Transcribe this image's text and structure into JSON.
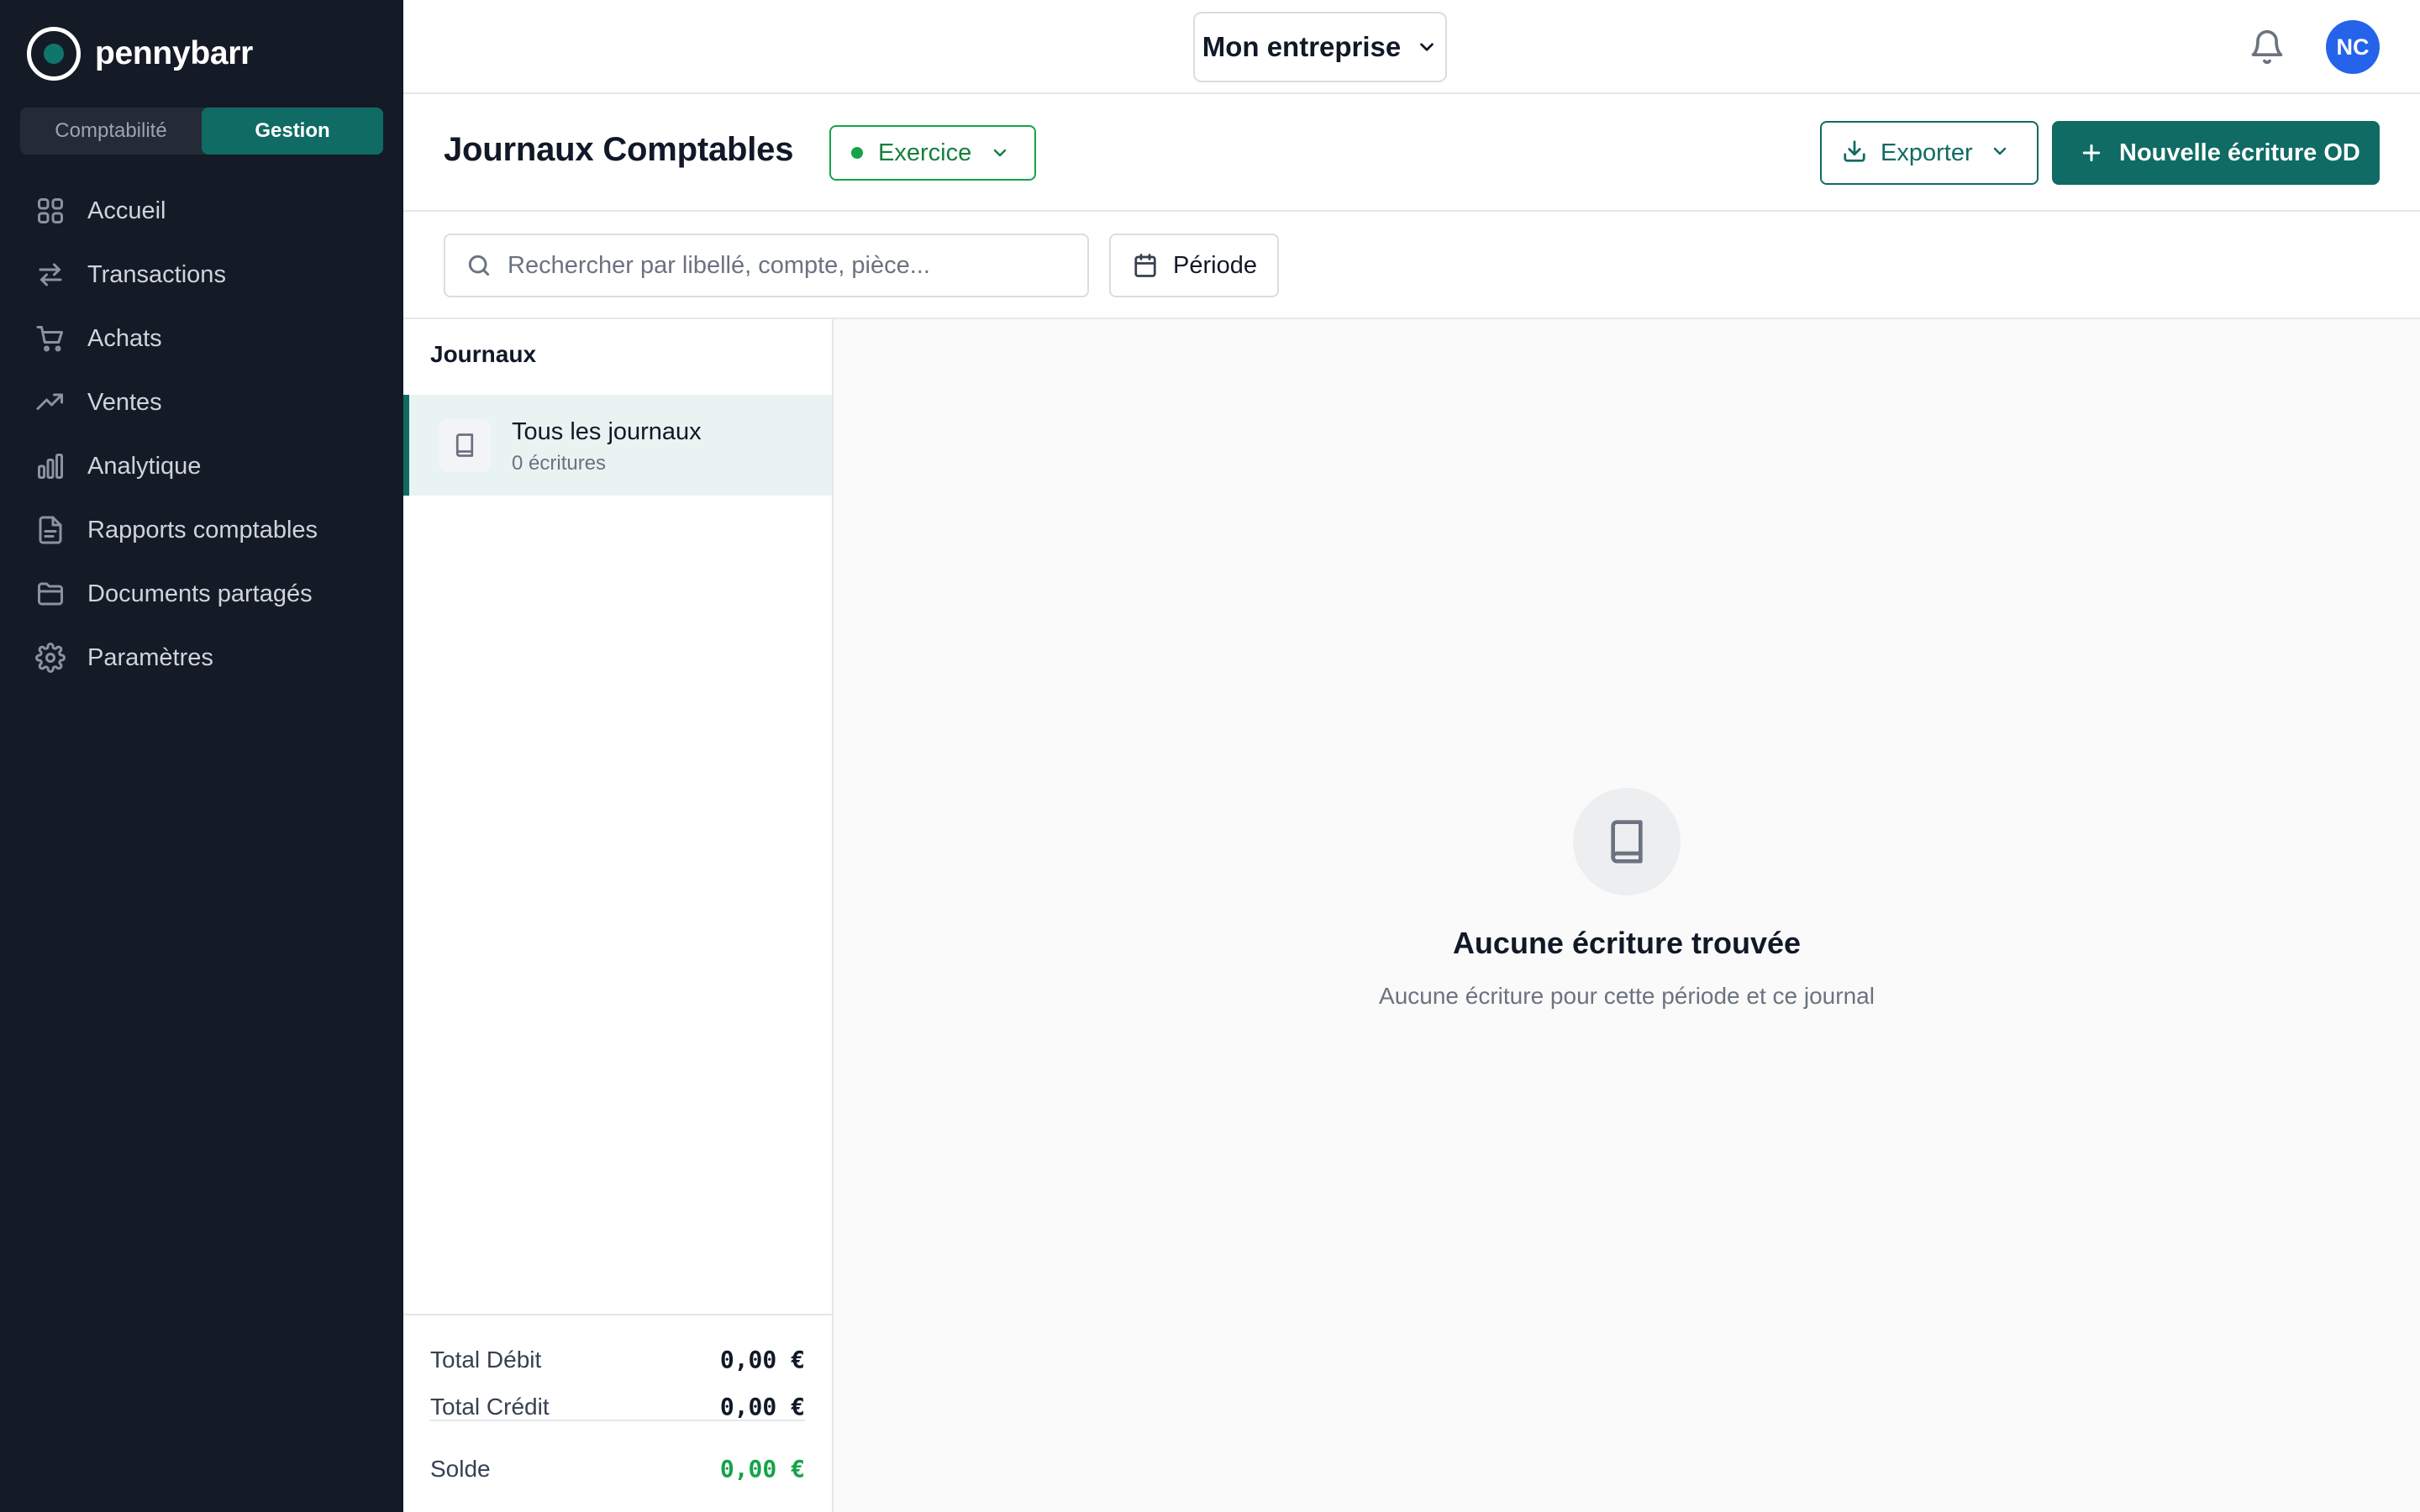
{
  "brand": {
    "name": "pennybarr"
  },
  "mode_switch": {
    "options": [
      "Comptabilité",
      "Gestion"
    ],
    "active": "Gestion"
  },
  "sidebar": {
    "items": [
      {
        "label": "Accueil",
        "icon": "grid-icon"
      },
      {
        "label": "Transactions",
        "icon": "arrows-left-right-icon"
      },
      {
        "label": "Achats",
        "icon": "cart-icon"
      },
      {
        "label": "Ventes",
        "icon": "trending-up-icon"
      },
      {
        "label": "Analytique",
        "icon": "bar-chart-icon"
      },
      {
        "label": "Rapports comptables",
        "icon": "file-text-icon"
      },
      {
        "label": "Documents partagés",
        "icon": "folder-icon"
      },
      {
        "label": "Paramètres",
        "icon": "gear-icon"
      }
    ]
  },
  "topbar": {
    "company": "Mon entreprise",
    "avatar_initials": "NC"
  },
  "header": {
    "title": "Journaux Comptables",
    "exercice_label": "Exercice",
    "export_label": "Exporter",
    "new_entry_label": "Nouvelle écriture OD"
  },
  "filters": {
    "search_placeholder": "Rechercher par libellé, compte, pièce...",
    "search_value": "",
    "period_label": "Période"
  },
  "journals": {
    "heading": "Journaux",
    "items": [
      {
        "name": "Tous les journaux",
        "count": "0 écritures",
        "selected": true
      }
    ]
  },
  "totals": {
    "debit_label": "Total Débit",
    "debit_value": "0,00 €",
    "credit_label": "Total Crédit",
    "credit_value": "0,00 €",
    "balance_label": "Solde",
    "balance_value": "0,00 €"
  },
  "empty_state": {
    "title": "Aucune écriture trouvée",
    "subtitle": "Aucune écriture pour cette période et ce journal"
  },
  "colors": {
    "sidebar_bg": "#151b26",
    "accent": "#0f6b63",
    "success": "#16a34a",
    "avatar": "#2563eb"
  }
}
